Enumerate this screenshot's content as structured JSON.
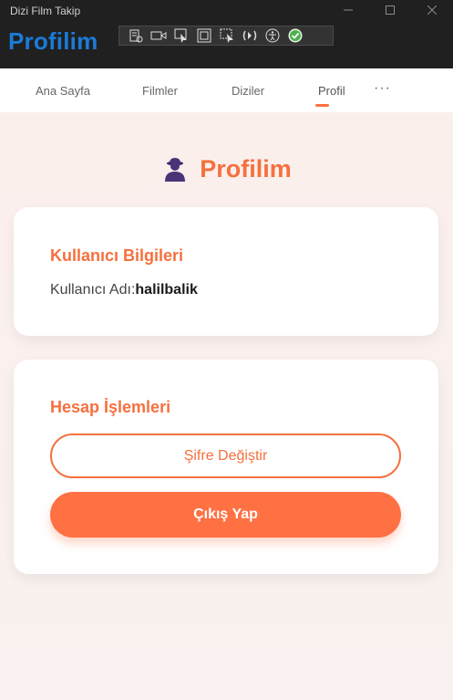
{
  "window": {
    "title": "Dizi Film Takip",
    "app_title": "Profilim",
    "controls": [
      "minimize-icon",
      "maximize-icon",
      "close-icon"
    ]
  },
  "devtools": {
    "icons": [
      "live-visual-tree-icon",
      "record-icon",
      "select-element-icon",
      "display-layout-adorners-icon",
      "track-focus-icon",
      "hot-reload-icon",
      "accessibility-icon",
      "check-icon"
    ]
  },
  "nav": {
    "tabs": [
      {
        "label": "Ana Sayfa",
        "active": false
      },
      {
        "label": "Filmler",
        "active": false
      },
      {
        "label": "Diziler",
        "active": false
      },
      {
        "label": "Profil",
        "active": true
      }
    ],
    "more": "···"
  },
  "page": {
    "heading": "Profilim",
    "heading_icon": "user-icon"
  },
  "user_info": {
    "title": "Kullanıcı Bilgileri",
    "username_label": "Kullanıcı Adı:",
    "username_value": "halilbalik"
  },
  "account": {
    "title": "Hesap İşlemleri",
    "change_password": "Şifre Değiştir",
    "logout": "Çıkış Yap"
  },
  "colors": {
    "accent": "#ff7043",
    "app_title": "#1a7bd8",
    "titlebar": "#202020"
  }
}
